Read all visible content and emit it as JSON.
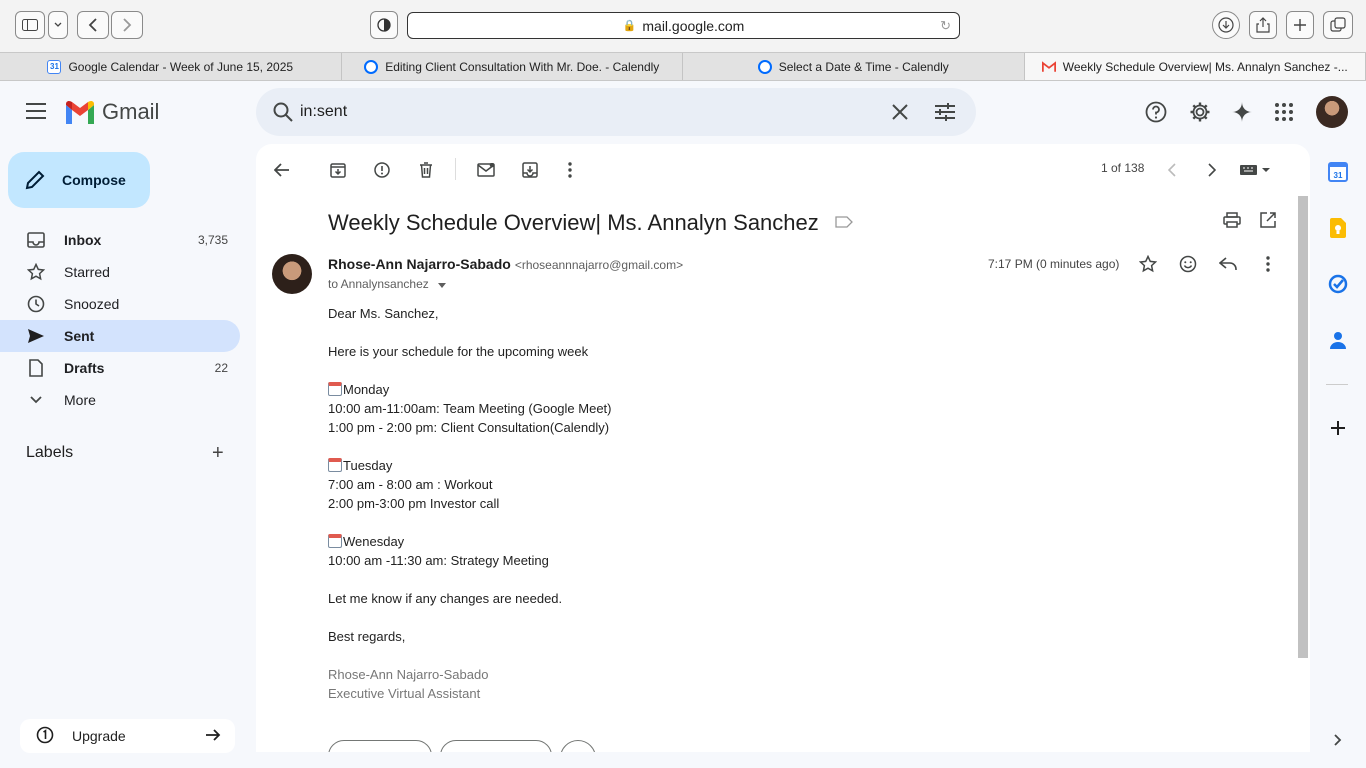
{
  "browser": {
    "url": "mail.google.com",
    "tabs": [
      {
        "title": "Google Calendar - Week of June 15, 2025",
        "icon": "calendar-favicon"
      },
      {
        "title": "Editing Client Consultation With Mr. Doe. - Calendly",
        "icon": "calendly-favicon"
      },
      {
        "title": "Select a Date & Time - Calendly",
        "icon": "calendly-favicon"
      },
      {
        "title": "Weekly Schedule Overview| Ms. Annalyn Sanchez -...",
        "icon": "gmail-favicon",
        "active": true
      }
    ]
  },
  "gmail": {
    "logo_text": "Gmail",
    "search": {
      "query": "in:sent"
    },
    "compose_label": "Compose",
    "nav": [
      {
        "label": "Inbox",
        "count": "3,735",
        "icon": "inbox-icon"
      },
      {
        "label": "Starred",
        "count": "",
        "icon": "star-icon"
      },
      {
        "label": "Snoozed",
        "count": "",
        "icon": "clock-icon"
      },
      {
        "label": "Sent",
        "count": "",
        "icon": "send-icon",
        "active": true
      },
      {
        "label": "Drafts",
        "count": "22",
        "icon": "draft-icon"
      },
      {
        "label": "More",
        "count": "",
        "icon": "chevron-down-icon"
      }
    ],
    "labels_title": "Labels",
    "upgrade_label": "Upgrade"
  },
  "message": {
    "pager": "1 of 138",
    "subject": "Weekly Schedule Overview| Ms. Annalyn Sanchez",
    "sender_name": "Rhose-Ann Najarro-Sabado",
    "sender_email": "<rhoseannnajarro@gmail.com>",
    "recipient": "to Annalynsanchez",
    "time": "7:17 PM (0 minutes ago)",
    "body": {
      "greeting": "Dear Ms. Sanchez,",
      "intro": "Here is your schedule for the upcoming week",
      "monday_title": "Monday",
      "monday_1": "10:00 am-11:00am: Team Meeting (Google Meet)",
      "monday_2": "1:00 pm - 2:00 pm: Client Consultation(Calendly)",
      "tuesday_title": "Tuesday",
      "tuesday_1": "7:00 am - 8:00 am : Workout",
      "tuesday_2": "2:00 pm-3:00 pm Investor call",
      "wednesday_title": "Wenesday",
      "wednesday_1": "10:00 am -11:30 am: Strategy Meeting",
      "closing_note": "Let me know if any changes are needed.",
      "signoff": "Best regards,",
      "sig_name": "Rhose-Ann Najarro-Sabado",
      "sig_title": "Executive Virtual Assistant"
    }
  }
}
